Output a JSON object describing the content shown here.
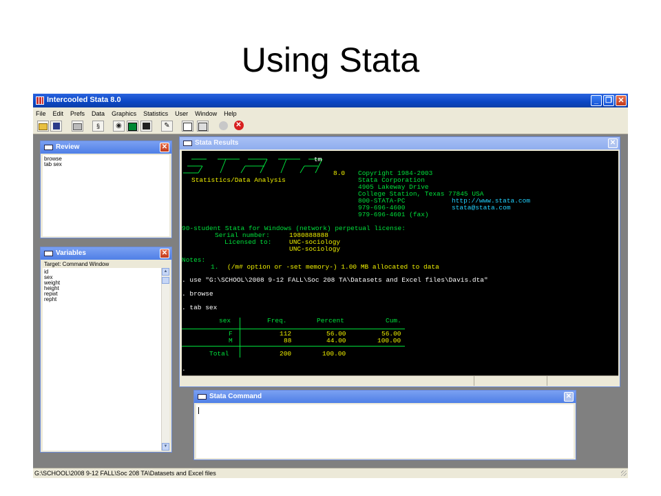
{
  "slide": {
    "title": "Using Stata"
  },
  "app": {
    "title": "Intercooled Stata 8.0",
    "menu": [
      "File",
      "Edit",
      "Prefs",
      "Data",
      "Graphics",
      "Statistics",
      "User",
      "Window",
      "Help"
    ],
    "toolbar_icons": [
      "open-icon",
      "save-icon",
      "print-icon",
      "log-icon",
      "viewer-icon",
      "graph-icon",
      "dofile-icon",
      "data-editor-icon",
      "data-browser-icon",
      "clear-more-icon",
      "break-icon"
    ]
  },
  "review": {
    "title": "Review",
    "items": [
      "browse",
      "tab sex"
    ]
  },
  "variables": {
    "title": "Variables",
    "header": "Target: Command Window",
    "items": [
      "id",
      "sex",
      "weight",
      "height",
      "repwt",
      "repht"
    ]
  },
  "results": {
    "title": "Stata Results",
    "tm": "tm",
    "version": "8.0",
    "tagline": "Statistics/Data Analysis",
    "copyright": [
      "Copyright 1984-2003",
      "Stata Corporation",
      "4905 Lakeway Drive",
      "College Station, Texas 77845 USA",
      "800-STATA-PC",
      "979-696-4600",
      "979-696-4601 (fax)"
    ],
    "web": "http://www.stata.com",
    "email": "stata@stata.com",
    "license_line": "90-student Stata for Windows (network) perpetual license:",
    "serial_label": "Serial number:",
    "serial_value": "1980888888",
    "licensed_label": "Licensed to:",
    "licensed_value1": "UNC-sociology",
    "licensed_value2": "UNC-sociology",
    "notes_label": "Notes:",
    "note1_num": "1.",
    "note1_text": "(/m# option or -set memory-) 1.00 MB allocated to data",
    "cmd_use": ". use \"G:\\SCHOOL\\2008 9-12 FALL\\Soc 208 TA\\Datasets and Excel files\\Davis.dta\"",
    "cmd_browse": ". browse",
    "cmd_tab": ". tab sex",
    "table": {
      "header": [
        "sex",
        "Freq.",
        "Percent",
        "Cum."
      ],
      "rows": [
        [
          "F",
          "112",
          "56.00",
          "56.00"
        ],
        [
          "M",
          "88",
          "44.00",
          "100.00"
        ]
      ],
      "total": [
        "Total",
        "200",
        "100.00"
      ]
    },
    "prompt": "."
  },
  "command": {
    "title": "Stata Command",
    "value": ""
  },
  "statusbar": {
    "path": "G:\\SCHOOL\\2008 9-12 FALL\\Soc 208 TA\\Datasets and Excel files"
  }
}
